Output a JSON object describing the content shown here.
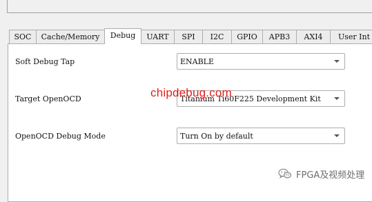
{
  "tabs": [
    {
      "label": "SOC",
      "active": false
    },
    {
      "label": "Cache/Memory",
      "active": false
    },
    {
      "label": "Debug",
      "active": true
    },
    {
      "label": "UART",
      "active": false
    },
    {
      "label": "SPI",
      "active": false
    },
    {
      "label": "I2C",
      "active": false
    },
    {
      "label": "GPIO",
      "active": false
    },
    {
      "label": "APB3",
      "active": false
    },
    {
      "label": "AXI4",
      "active": false
    },
    {
      "label": "User Int",
      "active": false
    }
  ],
  "settings": {
    "soft_debug_tap": {
      "label": "Soft Debug Tap",
      "value": "ENABLE"
    },
    "target_openocd": {
      "label": "Target OpenOCD",
      "value": "Titanium Ti60F225 Development Kit"
    },
    "openocd_debug_mode": {
      "label": "OpenOCD Debug Mode",
      "value": "Turn On by default"
    }
  },
  "watermark": {
    "site": "chipdebug.com",
    "wechat_text": "FPGA及视频处理",
    "wechat_icon": "wechat-logo-icon"
  },
  "colors": {
    "watermark_red": "#e3201b",
    "panel_bg": "#ffffff",
    "window_bg": "#f0f0f0"
  }
}
